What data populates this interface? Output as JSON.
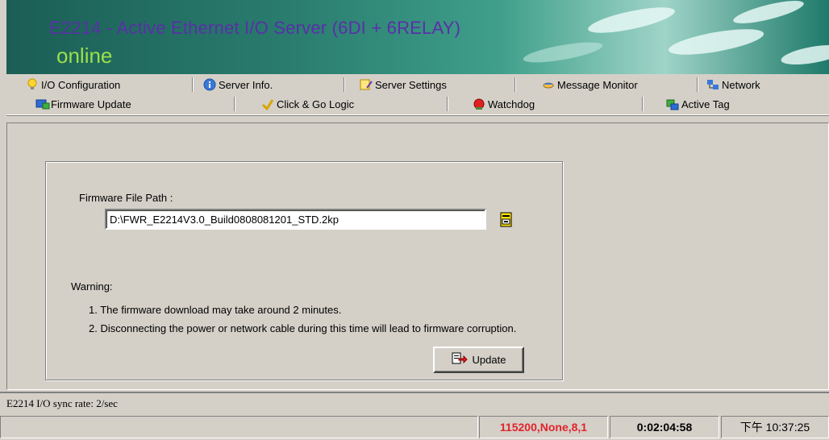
{
  "header": {
    "title": "E2214 - Active Ethernet I/O Server (6DI + 6RELAY)",
    "status": "online"
  },
  "tabs": {
    "row1": [
      {
        "label": "I/O Configuration",
        "icon": "lightbulb-icon"
      },
      {
        "label": "Server Info.",
        "icon": "info-icon"
      },
      {
        "label": "Server Settings",
        "icon": "settings-icon"
      },
      {
        "label": "Message Monitor",
        "icon": "message-icon"
      },
      {
        "label": "Network",
        "icon": "network-icon"
      }
    ],
    "row2": [
      {
        "label": "Firmware Update",
        "icon": "firmware-icon"
      },
      {
        "label": "Click & Go Logic",
        "icon": "logic-icon"
      },
      {
        "label": "Watchdog",
        "icon": "watchdog-icon"
      },
      {
        "label": "Active Tag",
        "icon": "tag-icon"
      }
    ],
    "active": "Firmware Update"
  },
  "firmware": {
    "path_label": "Firmware File Path :",
    "path_value": "D:\\FWR_E2214V3.0_Build0808081201_STD.2kp",
    "warning_title": "Warning:",
    "warning_1": "1. The firmware download may take around 2 minutes.",
    "warning_2": "2. Disconnecting the power or network cable during this time will lead to firmware corruption.",
    "update_label": "Update"
  },
  "sync": {
    "text": "E2214 I/O sync rate: 2/sec"
  },
  "statusbar": {
    "port": "115200,None,8,1",
    "elapsed": "0:02:04:58",
    "clock": "下午 10:37:25"
  },
  "colors": {
    "title": "#5a2fa8",
    "online": "#9be04a",
    "port": "#e3222b",
    "panel": "#d4d0c8"
  }
}
